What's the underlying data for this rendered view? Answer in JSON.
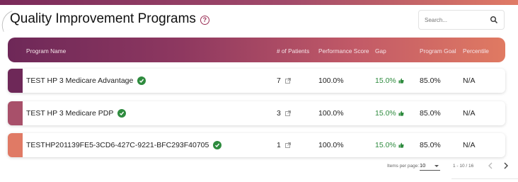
{
  "page": {
    "title": "Quality Improvement Programs"
  },
  "search": {
    "placeholder": "Search..."
  },
  "table": {
    "columns": {
      "name": "Program Name",
      "patients": "# of Patients",
      "score": "Performance Score",
      "gap": "Gap",
      "goal": "Program Goal",
      "percentile": "Percentile"
    },
    "rows": [
      {
        "name": "TEST HP 3 Medicare Advantage",
        "patients": "7",
        "score": "100.0%",
        "gap": "15.0%",
        "goal": "85.0%",
        "percentile": "N/A",
        "color": "#6e2858"
      },
      {
        "name": "TEST HP 3 Medicare PDP",
        "patients": "3",
        "score": "100.0%",
        "gap": "15.0%",
        "goal": "85.0%",
        "percentile": "N/A",
        "color": "#a8506a"
      },
      {
        "name": "TESTHP201139FE5-3CD6-427C-9221-BFC293F40705",
        "patients": "1",
        "score": "100.0%",
        "gap": "15.0%",
        "goal": "85.0%",
        "percentile": "N/A",
        "color": "#e07a65"
      }
    ]
  },
  "pagination": {
    "items_per_page_label": "Items per page:",
    "items_per_page": "10",
    "range": "1 - 10 / 16"
  },
  "icons": {
    "help": "help-circle-icon",
    "search": "search-icon",
    "verified": "check-circle-icon",
    "external": "external-link-icon",
    "thumb": "thumbs-up-icon",
    "prev": "chevron-left-icon",
    "next": "chevron-right-icon"
  },
  "colors": {
    "accent": "#9b2f56",
    "good": "#2e8b3e"
  }
}
